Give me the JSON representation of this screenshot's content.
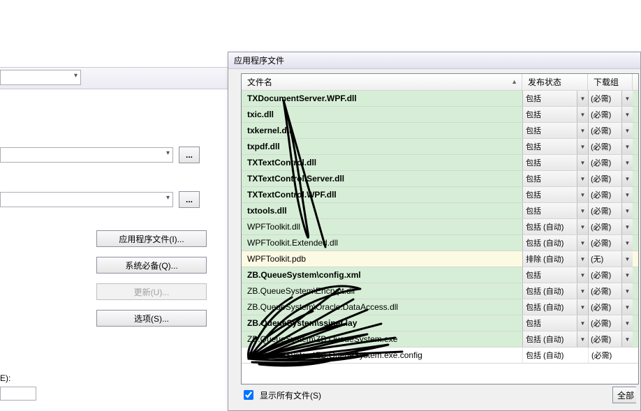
{
  "dialog_title": "应用程序文件",
  "columns": {
    "name": "文件名",
    "status": "发布状态",
    "group": "下载组"
  },
  "left": {
    "buttons": {
      "app_files": "应用程序文件(I)...",
      "prereq": "系统必备(Q)...",
      "update": "更新(U)...",
      "options": "选项(S)..."
    },
    "label_e": "E):",
    "browse": "..."
  },
  "footer": {
    "show_all": "显示所有文件(S)",
    "reset": "全部"
  },
  "status_labels": {
    "include": "包括",
    "include_auto": "包括 (自动)",
    "exclude_auto": "排除 (自动)"
  },
  "group_labels": {
    "required": "(必需)",
    "none": "(无)"
  },
  "rows": [
    {
      "name": "TXDocumentServer.WPF.dll",
      "status": "include",
      "group": "required",
      "style": "included"
    },
    {
      "name": "txic.dll",
      "status": "include",
      "group": "required",
      "style": "included"
    },
    {
      "name": "txkernel.dll",
      "status": "include",
      "group": "required",
      "style": "included"
    },
    {
      "name": "txpdf.dll",
      "status": "include",
      "group": "required",
      "style": "included"
    },
    {
      "name": "TXTextControl.dll",
      "status": "include",
      "group": "required",
      "style": "included"
    },
    {
      "name": "TXTextControl.Server.dll",
      "status": "include",
      "group": "required",
      "style": "included"
    },
    {
      "name": "TXTextControl.WPF.dll",
      "status": "include",
      "group": "required",
      "style": "included"
    },
    {
      "name": "txtools.dll",
      "status": "include",
      "group": "required",
      "style": "included"
    },
    {
      "name": "WPFToolkit.dll",
      "status": "include_auto",
      "group": "required",
      "style": "auto-inc"
    },
    {
      "name": "WPFToolkit.Extended.dll",
      "status": "include_auto",
      "group": "required",
      "style": "auto-inc"
    },
    {
      "name": "WPFToolkit.pdb",
      "status": "exclude_auto",
      "group": "none",
      "style": "excluded"
    },
    {
      "name": "ZB.QueueSystem\\config.xml",
      "status": "include",
      "group": "required",
      "style": "included"
    },
    {
      "name": "ZB.QueueSystem\\Encrypt.dll",
      "status": "include_auto",
      "group": "required",
      "style": "auto-inc"
    },
    {
      "name": "ZB.QueueSystem\\Oracle.DataAccess.dll",
      "status": "include_auto",
      "group": "required",
      "style": "auto-inc"
    },
    {
      "name": "ZB.QueueSystem\\ssinet.lay",
      "status": "include",
      "group": "required",
      "style": "included"
    },
    {
      "name": "ZB.QueueSystem\\ZB.QueueSystem.exe",
      "status": "include_auto",
      "group": "required",
      "style": "auto-inc"
    },
    {
      "name": "ZB.QueueSystem\\ZB.QueueSystem.exe.config",
      "status": "include_auto",
      "group": "required",
      "style": "plain",
      "plain": true
    }
  ]
}
